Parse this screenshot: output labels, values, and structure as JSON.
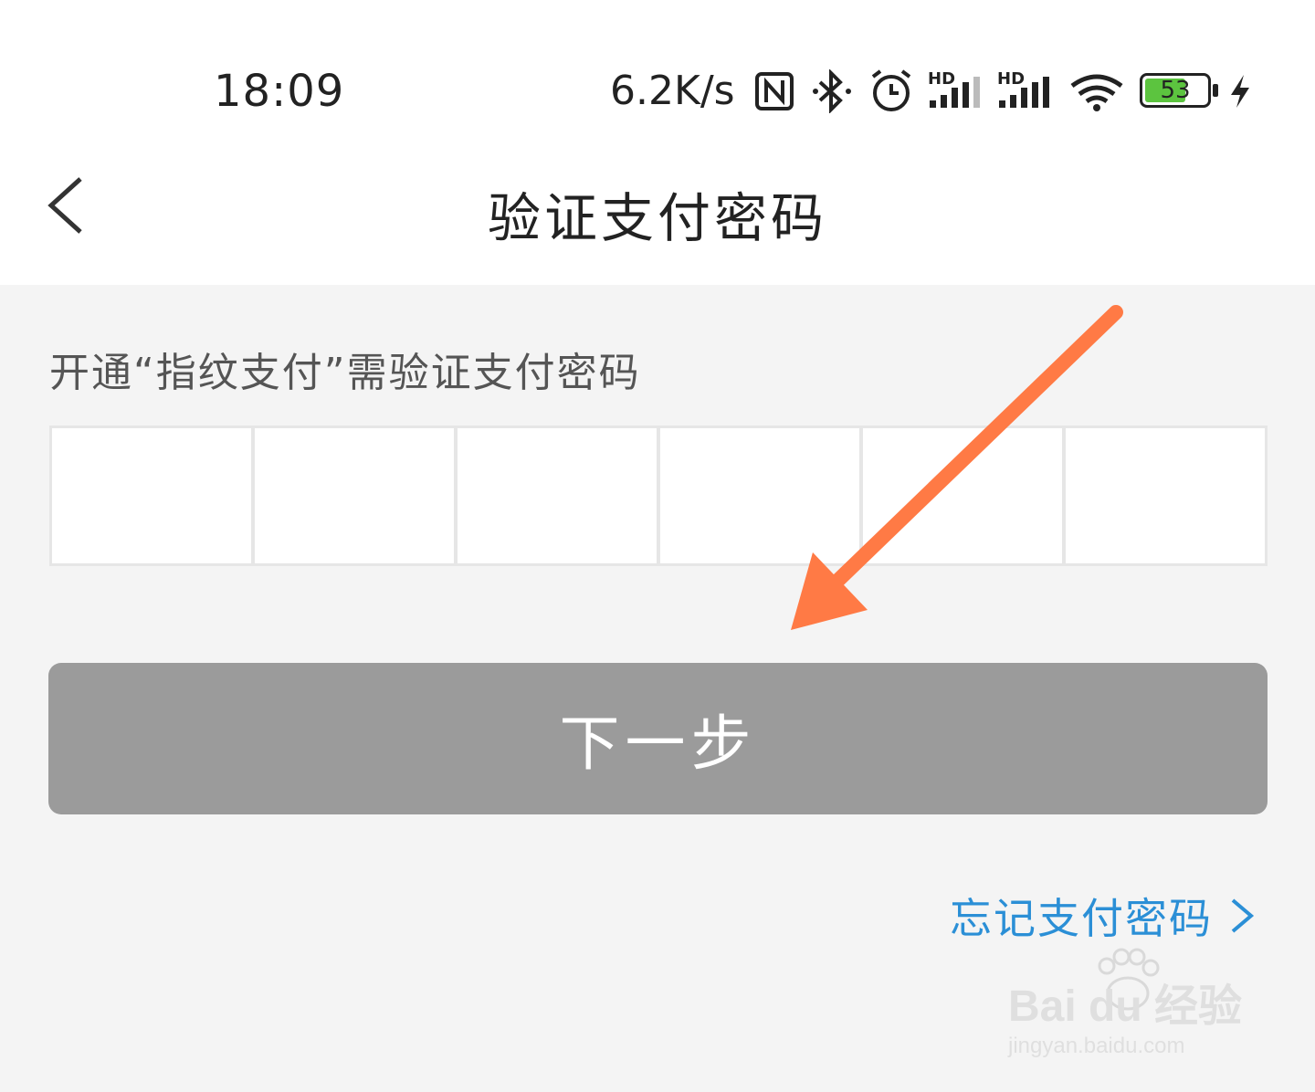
{
  "status_bar": {
    "time": "18:09",
    "net_speed": "6.2K/s",
    "signal1_label": "HD",
    "signal2_label": "HD",
    "battery_level": "53",
    "icons": [
      "nfc-icon",
      "bluetooth-icon",
      "alarm-icon",
      "signal-icon",
      "signal-icon",
      "wifi-icon",
      "battery-icon",
      "charging-icon"
    ]
  },
  "header": {
    "title": "验证支付密码",
    "back_icon": "chevron-left-icon"
  },
  "main": {
    "hint": "开通“指纹支付”需验证支付密码",
    "password_cells": 6,
    "next_label": "下一步",
    "forgot_label": "忘记支付密码",
    "forgot_icon": "chevron-right-icon"
  },
  "watermark": {
    "brand": "Bai du 经验",
    "url": "jingyan.baidu.com"
  },
  "colors": {
    "accent_link": "#2b8fd6",
    "button_disabled": "#9b9b9b",
    "annotation_arrow": "#ff7a45",
    "battery_fill": "#5cc43f"
  }
}
